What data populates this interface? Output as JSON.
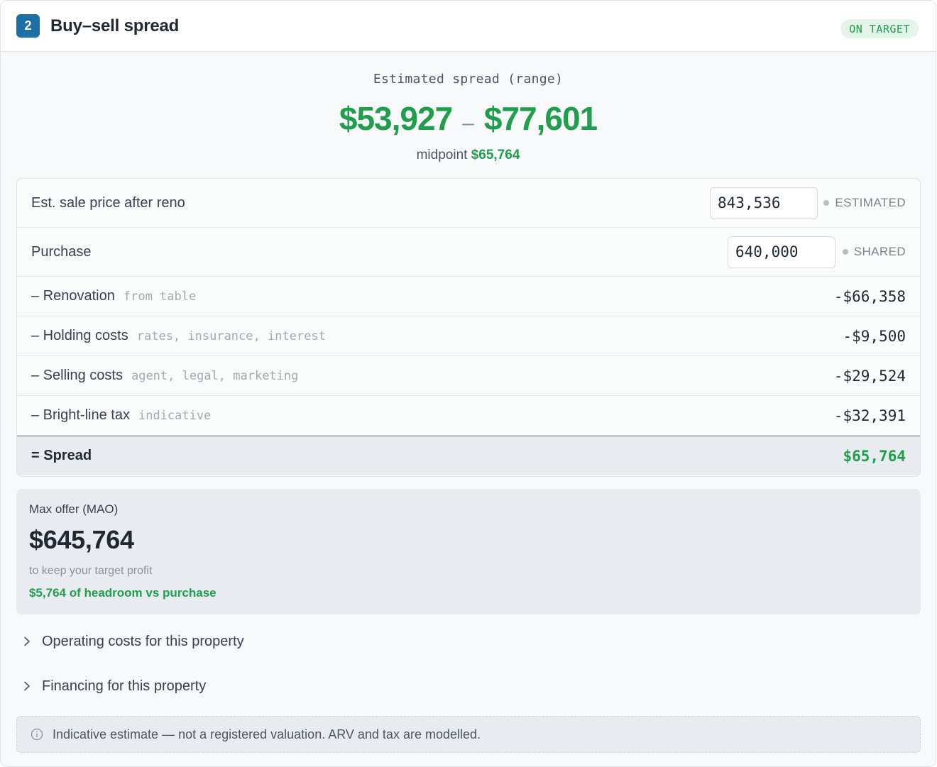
{
  "header": {
    "step_number": "2",
    "title": "Buy–sell spread",
    "status": "ON TARGET"
  },
  "summary": {
    "label": "Estimated spread (range)",
    "low": "$53,927",
    "separator": "–",
    "high": "$77,601",
    "midpoint_label": "midpoint",
    "midpoint_value": "$65,764"
  },
  "ledger": {
    "sale_price": {
      "label": "Est. sale price after reno",
      "value": "843,536",
      "tag": "ESTIMATED"
    },
    "purchase": {
      "label": "Purchase",
      "value": "640,000",
      "tag": "SHARED"
    },
    "lines": [
      {
        "label": "– Renovation",
        "note": "from table",
        "amount": "-$66,358"
      },
      {
        "label": "– Holding costs",
        "note": "rates, insurance, interest",
        "amount": "-$9,500"
      },
      {
        "label": "– Selling costs",
        "note": "agent, legal, marketing",
        "amount": "-$29,524"
      },
      {
        "label": "– Bright-line tax",
        "note": "indicative",
        "amount": "-$32,391"
      }
    ],
    "total": {
      "label": "= Spread",
      "amount": "$65,764"
    }
  },
  "mao": {
    "title": "Max offer (MAO)",
    "value": "$645,764",
    "subtitle": "to keep your target profit",
    "headroom": "$5,764 of headroom vs purchase"
  },
  "sections": [
    {
      "label": "Operating costs for this property",
      "icon": "chevron-right-icon"
    },
    {
      "label": "Financing for this property",
      "icon": "chevron-right-icon"
    }
  ],
  "disclaimer": {
    "icon": "info-icon",
    "text": "Indicative estimate — not a registered valuation. ARV and tax are modelled."
  },
  "colors": {
    "accent_green": "#1f9e4b",
    "badge_blue": "#1d6fa5",
    "pill_background": "#e3f5e8"
  }
}
